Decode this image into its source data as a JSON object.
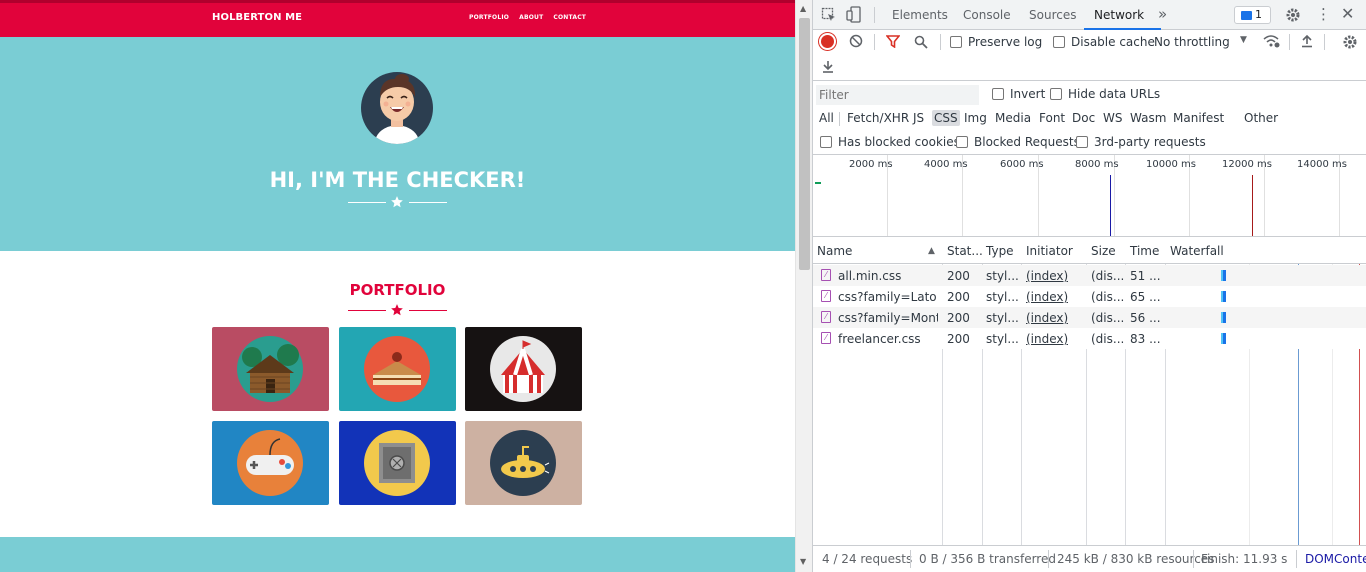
{
  "site": {
    "brand": "HOLBERTON ME",
    "nav": [
      "PORTFOLIO",
      "ABOUT",
      "CONTACT"
    ],
    "hero_title": "HI, I'M THE CHECKER!",
    "portfolio_title": "PORTFOLIO",
    "colors": {
      "red": "#e1033b",
      "teal": "#7acdd4"
    },
    "tiles": [
      {
        "name": "cabin",
        "bg": "#b94c63"
      },
      {
        "name": "cake",
        "bg": "#23a6b3"
      },
      {
        "name": "circus",
        "bg": "#161212"
      },
      {
        "name": "game",
        "bg": "#2186c4"
      },
      {
        "name": "safe",
        "bg": "#1233b8"
      },
      {
        "name": "submarine",
        "bg": "#cdb1a2"
      }
    ]
  },
  "devtools": {
    "tabs": [
      "Elements",
      "Console",
      "Sources",
      "Network"
    ],
    "more_tabs_icon": "»",
    "message_count": "1",
    "toolbar": {
      "preserve_log": "Preserve log",
      "disable_cache": "Disable cache",
      "throttling": "No throttling"
    },
    "filter": {
      "placeholder": "Filter",
      "invert": "Invert",
      "hide_data_urls": "Hide data URLs",
      "types": [
        "All",
        "Fetch/XHR",
        "JS",
        "CSS",
        "Img",
        "Media",
        "Font",
        "Doc",
        "WS",
        "Wasm",
        "Manifest",
        "Other"
      ],
      "active_type": "CSS",
      "has_blocked_cookies": "Has blocked cookies",
      "blocked_requests": "Blocked Requests",
      "third_party": "3rd-party requests"
    },
    "overview_ticks": [
      "2000 ms",
      "4000 ms",
      "6000 ms",
      "8000 ms",
      "10000 ms",
      "12000 ms",
      "14000 ms"
    ],
    "columns": [
      "Name",
      "Stat...",
      "Type",
      "Initiator",
      "Size",
      "Time",
      "Waterfall"
    ],
    "rows": [
      {
        "name": "all.min.css",
        "status": "200",
        "type": "styl...",
        "initiator": "(index)",
        "size": "(dis...",
        "time": "51 ..."
      },
      {
        "name": "css?family=Lato:...",
        "status": "200",
        "type": "styl...",
        "initiator": "(index)",
        "size": "(dis...",
        "time": "65 ..."
      },
      {
        "name": "css?family=Mont...",
        "status": "200",
        "type": "styl...",
        "initiator": "(index)",
        "size": "(dis...",
        "time": "56 ..."
      },
      {
        "name": "freelancer.css",
        "status": "200",
        "type": "styl...",
        "initiator": "(index)",
        "size": "(dis...",
        "time": "83 ..."
      }
    ],
    "status": {
      "requests": "4 / 24 requests",
      "transferred": "0 B / 356 B transferred",
      "resources": "245 kB / 830 kB resources",
      "finish": "Finish: 11.93 s",
      "dom": "DOMConte"
    }
  }
}
